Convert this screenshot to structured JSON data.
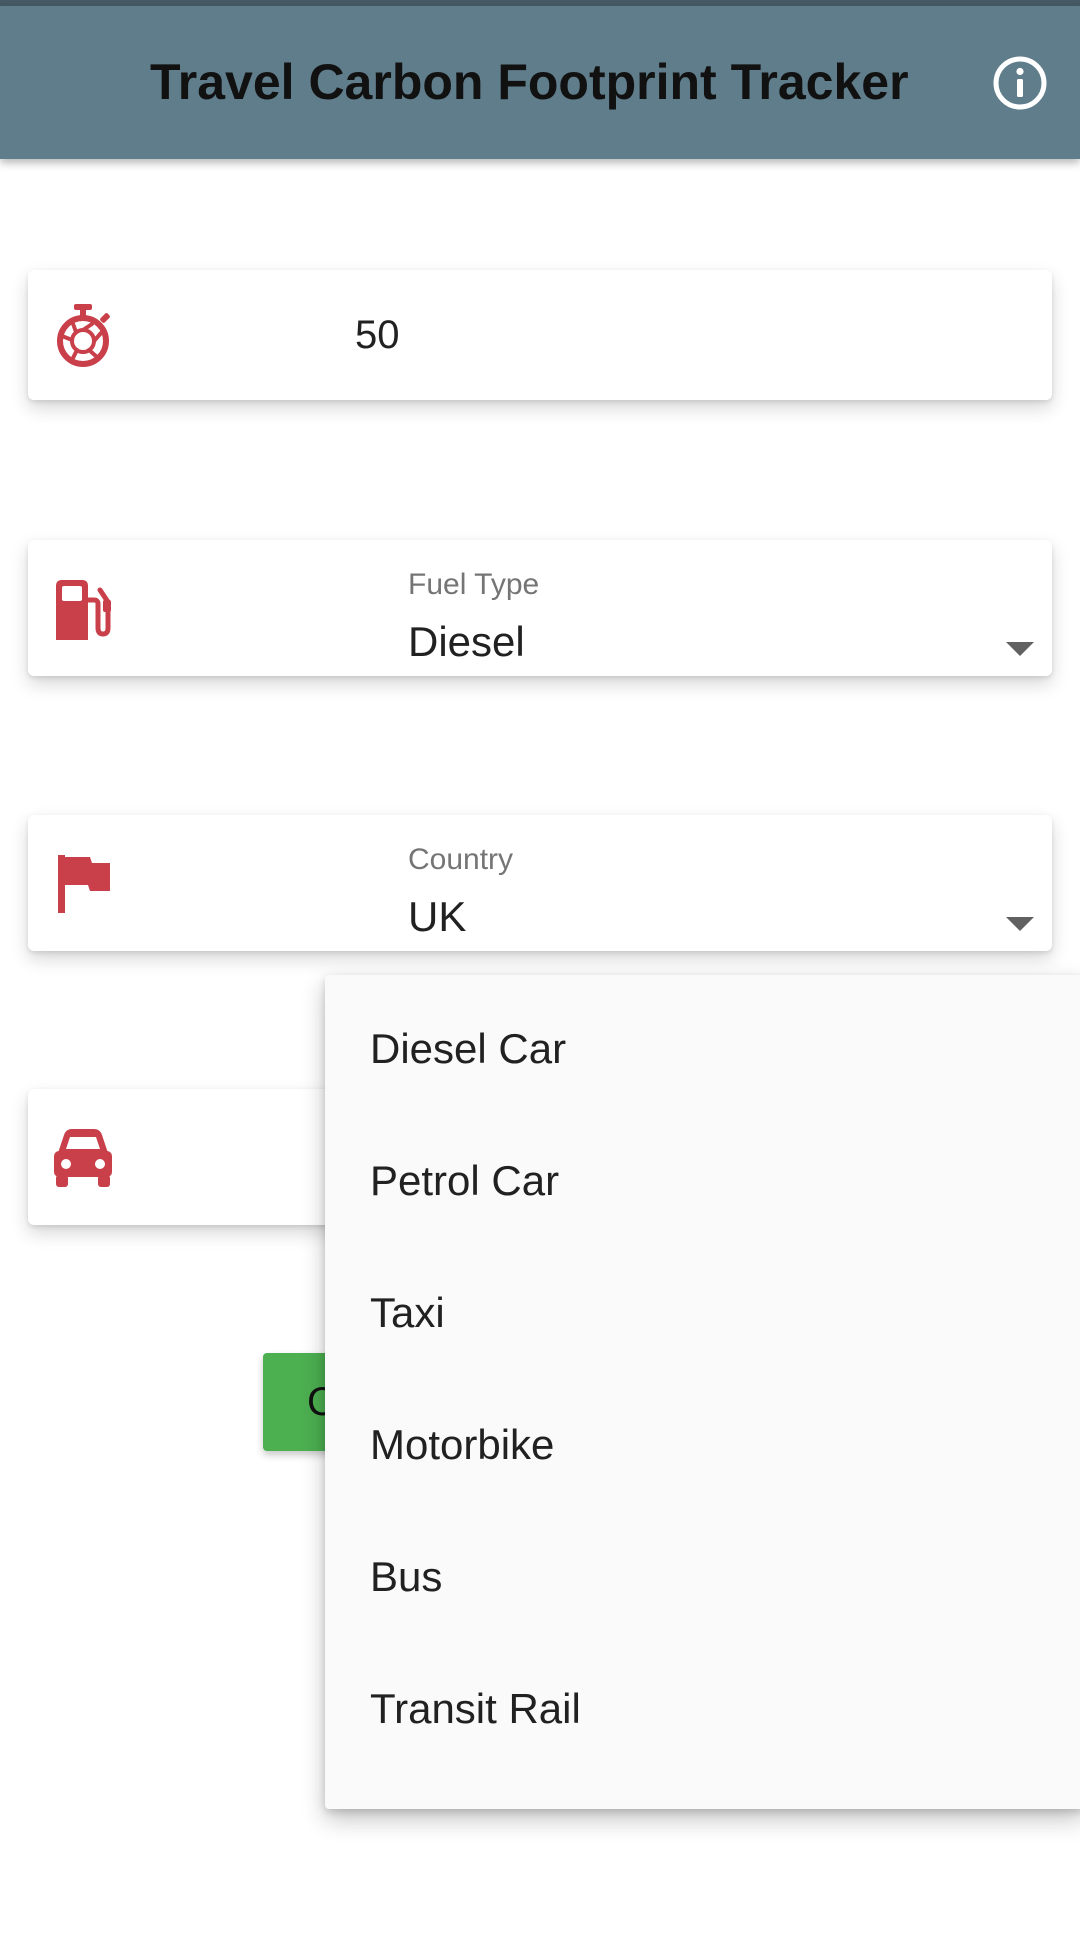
{
  "app_bar": {
    "title": "Travel Carbon Footprint Tracker",
    "info_icon": "info-circle-icon",
    "background_color": "#607d8b"
  },
  "distance_field": {
    "icon": "stopwatch-icon",
    "value": "50"
  },
  "fuel_type_field": {
    "icon": "fuel-pump-icon",
    "label": "Fuel Type",
    "value": "Diesel"
  },
  "country_field": {
    "icon": "flag-icon",
    "label": "Country",
    "value": "UK"
  },
  "vehicle_field": {
    "icon": "car-icon"
  },
  "calculate_button": {
    "label": "C",
    "color": "#4caf50"
  },
  "vehicle_menu": {
    "options": [
      "Diesel Car",
      "Petrol Car",
      "Taxi",
      "Motorbike",
      "Bus",
      "Transit Rail"
    ]
  },
  "colors": {
    "icon_accent": "#c9404a"
  }
}
